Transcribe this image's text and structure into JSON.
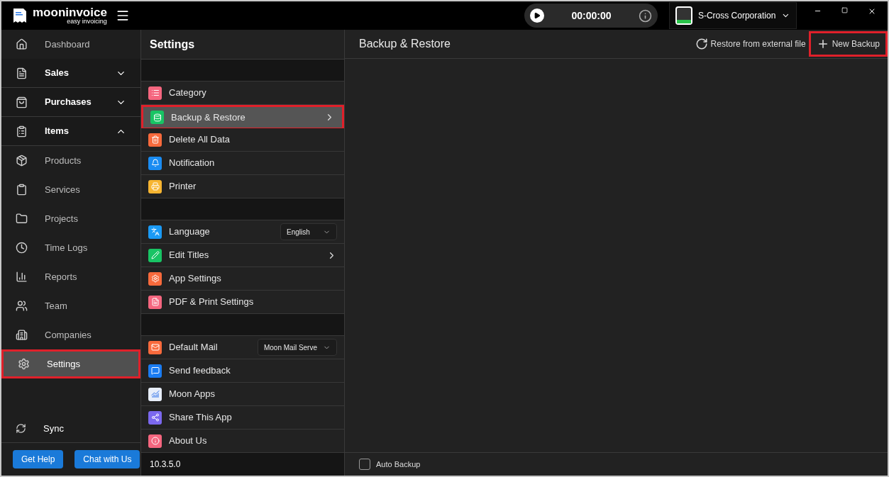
{
  "app": {
    "logo_name": "mooninvoice",
    "logo_tagline": "easy invoicing"
  },
  "timer": {
    "time": "00:00:00"
  },
  "company": {
    "name": "S-Cross Corporation"
  },
  "sidebar": {
    "items": [
      {
        "label": "Dashboard",
        "kind": "link",
        "selected": false
      },
      {
        "label": "Sales",
        "kind": "group",
        "expanded": false,
        "selected": false
      },
      {
        "label": "Purchases",
        "kind": "group",
        "expanded": false,
        "selected": false
      },
      {
        "label": "Items",
        "kind": "group",
        "expanded": true,
        "selected": false,
        "children": [
          {
            "label": "Products",
            "selected": false
          },
          {
            "label": "Services",
            "selected": false
          }
        ]
      },
      {
        "label": "Projects",
        "kind": "link",
        "selected": false
      },
      {
        "label": "Time Logs",
        "kind": "link",
        "selected": false
      },
      {
        "label": "Reports",
        "kind": "link",
        "selected": false
      },
      {
        "label": "Team",
        "kind": "link",
        "selected": false
      },
      {
        "label": "Companies",
        "kind": "link",
        "selected": false
      },
      {
        "label": "Settings",
        "kind": "link",
        "selected": true
      }
    ],
    "sync": "Sync",
    "buttons": [
      "Get Help",
      "Chat with Us"
    ]
  },
  "settings": {
    "title": "Settings",
    "groups": [
      {
        "items": [
          {
            "label": "Category",
            "kind": "plain",
            "color": "#f5667f",
            "selected": false
          },
          {
            "label": "Backup & Restore",
            "kind": "chevron",
            "color": "#18c464",
            "selected": true
          },
          {
            "label": "Delete All Data",
            "kind": "plain",
            "color": "#f86a3c",
            "selected": false
          },
          {
            "label": "Notification",
            "kind": "plain",
            "color": "#1a8cf2",
            "selected": false
          },
          {
            "label": "Printer",
            "kind": "plain",
            "color": "#f7b531",
            "selected": false
          }
        ]
      },
      {
        "items": [
          {
            "label": "Language",
            "kind": "dropdown",
            "value": "English",
            "color": "#1a9af5",
            "selected": false
          },
          {
            "label": "Edit Titles",
            "kind": "chevron",
            "color": "#18c464",
            "selected": false
          },
          {
            "label": "App Settings",
            "kind": "plain",
            "color": "#f86a3c",
            "selected": false
          },
          {
            "label": "PDF & Print Settings",
            "kind": "plain",
            "color": "#f5667f",
            "selected": false
          }
        ]
      },
      {
        "items": [
          {
            "label": "Default Mail",
            "kind": "dropdown",
            "value": "Moon Mail Serve",
            "color": "#f86a3c",
            "selected": false
          },
          {
            "label": "Send feedback",
            "kind": "plain",
            "color": "#1a7cf2",
            "selected": false
          },
          {
            "label": "Moon Apps",
            "kind": "plain",
            "color": "#e8eefa",
            "selected": false
          },
          {
            "label": "Share This App",
            "kind": "plain",
            "color": "#7b68ee",
            "selected": false
          },
          {
            "label": "About Us",
            "kind": "plain",
            "color": "#f5667f",
            "selected": false
          }
        ]
      }
    ],
    "version": "10.3.5.0"
  },
  "content": {
    "title": "Backup & Restore",
    "restore_button": "Restore from external file",
    "new_backup_button": "New Backup",
    "new_backup_highlighted": true,
    "auto_backup": {
      "label": "Auto Backup",
      "checked": false
    }
  }
}
